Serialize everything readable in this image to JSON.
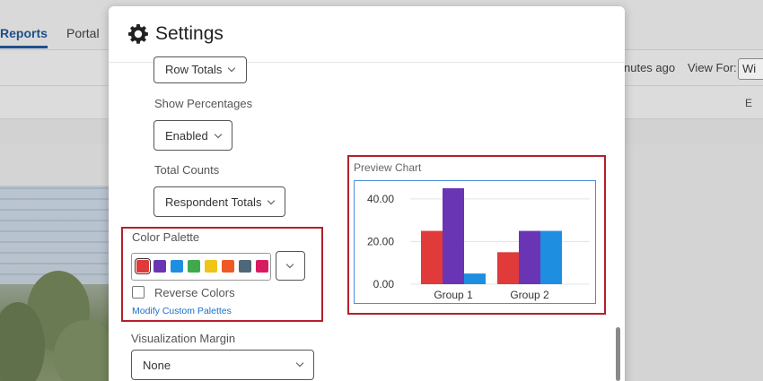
{
  "background": {
    "tabs": [
      "Reports",
      "Portal"
    ],
    "updated_text": "nutes ago",
    "view_for_label": "View For:",
    "view_for_value": "Wi",
    "row_button": "E"
  },
  "modal": {
    "title": "Settings",
    "row_totals_value": "Row Totals",
    "show_percentages_label": "Show Percentages",
    "show_percentages_value": "Enabled",
    "total_counts_label": "Total Counts",
    "total_counts_value": "Respondent Totals",
    "color_palette_label": "Color Palette",
    "palette_colors": [
      "#e03a3a",
      "#6a35b5",
      "#1e8fe0",
      "#3eaa4c",
      "#f0c419",
      "#ef5a24",
      "#4f6878",
      "#d81b60"
    ],
    "reverse_colors_label": "Reverse Colors",
    "reverse_colors_checked": false,
    "modify_palettes_link": "Modify Custom Palettes",
    "visualization_margin_label": "Visualization Margin",
    "visualization_margin_value": "None",
    "preview_chart_label": "Preview Chart"
  },
  "chart_data": {
    "type": "bar",
    "categories": [
      "Group 1",
      "Group 2"
    ],
    "series": [
      {
        "values": [
          25,
          15
        ],
        "color": "#e03a3a"
      },
      {
        "values": [
          45,
          25
        ],
        "color": "#6a35b5"
      },
      {
        "values": [
          5,
          25
        ],
        "color": "#1e8fe0"
      }
    ],
    "yticks": [
      "40.00",
      "20.00",
      "0.00"
    ],
    "ytick_values": [
      40,
      20,
      0
    ],
    "ylim": [
      0,
      45
    ],
    "grid": true
  }
}
